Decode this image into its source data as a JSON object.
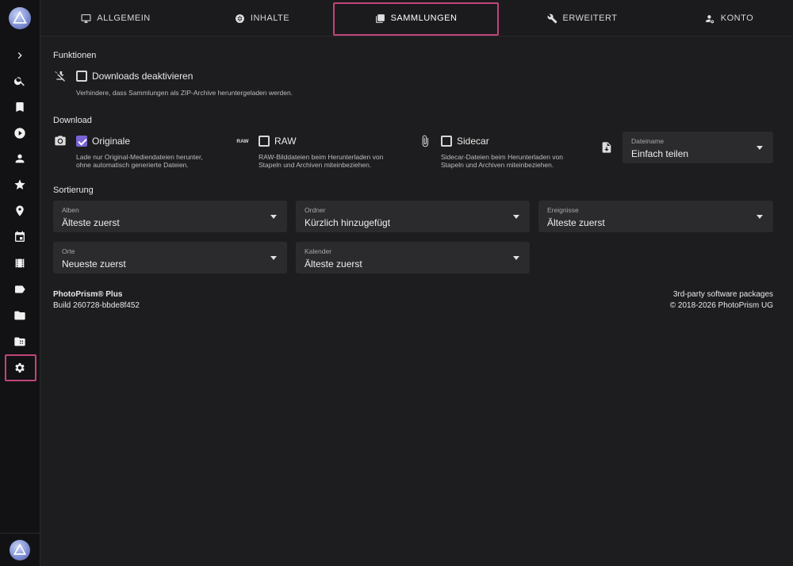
{
  "tabs": {
    "general": "ALLGEMEIN",
    "content": "INHALTE",
    "collections": "SAMMLUNGEN",
    "advanced": "ERWEITERT",
    "account": "KONTO"
  },
  "sidebar": {
    "icons": [
      "expand-icon",
      "search-icon",
      "bookmark-icon",
      "play-icon",
      "person-icon",
      "star-icon",
      "location-icon",
      "calendar-icon",
      "film-icon",
      "label-icon",
      "folder-icon",
      "library-icon",
      "settings-icon"
    ]
  },
  "functions": {
    "title": "Funktionen",
    "disable_downloads_label": "Downloads deaktivieren",
    "disable_downloads_hint": "Verhindere, dass Sammlungen als ZIP-Archive heruntergeladen werden."
  },
  "download": {
    "title": "Download",
    "originals_label": "Originale",
    "originals_hint_1": "Lade nur Original-Mediendateien herunter,",
    "originals_hint_2": "ohne automatisch generierte Dateien.",
    "raw_badge": "RAW",
    "raw_label": "RAW",
    "raw_hint_1": "RAW-Bilddateien beim Herunterladen von",
    "raw_hint_2": "Stapeln und Archiven miteinbeziehen.",
    "sidecar_label": "Sidecar",
    "sidecar_hint_1": "Sidecar-Dateien beim Herunterladen von",
    "sidecar_hint_2": "Stapeln und Archiven miteinbeziehen.",
    "filename_label": "Dateiname",
    "filename_value": "Einfach teilen"
  },
  "sorting": {
    "title": "Sortierung",
    "albums_label": "Alben",
    "albums_value": "Älteste zuerst",
    "folders_label": "Ordner",
    "folders_value": "Kürzlich hinzugefügt",
    "moments_label": "Ereignisse",
    "moments_value": "Älteste zuerst",
    "places_label": "Orte",
    "places_value": "Neueste zuerst",
    "calendar_label": "Kalender",
    "calendar_value": "Älteste zuerst"
  },
  "footer": {
    "product": "PhotoPrism® Plus",
    "build": "Build 260728-bbde8f452",
    "packages": "3rd-party software packages",
    "copyright": "© 2018-2026 PhotoPrism UG"
  },
  "colors": {
    "accent": "#7a63d4",
    "highlight": "#c0457a",
    "background": "#1d1d1f"
  }
}
